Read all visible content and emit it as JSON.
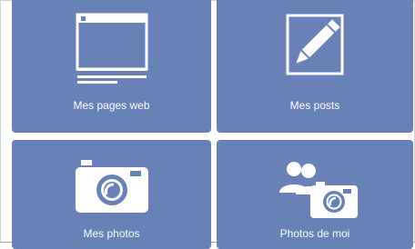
{
  "tiles": [
    {
      "label": "Mes pages web",
      "icon": "web-page-icon"
    },
    {
      "label": "Mes posts",
      "icon": "pencil-icon"
    },
    {
      "label": "Mes photos",
      "icon": "camera-icon"
    },
    {
      "label": "Photos de moi",
      "icon": "people-camera-icon"
    }
  ],
  "colors": {
    "tile_bg": "#6882b7",
    "icon": "#ffffff"
  }
}
